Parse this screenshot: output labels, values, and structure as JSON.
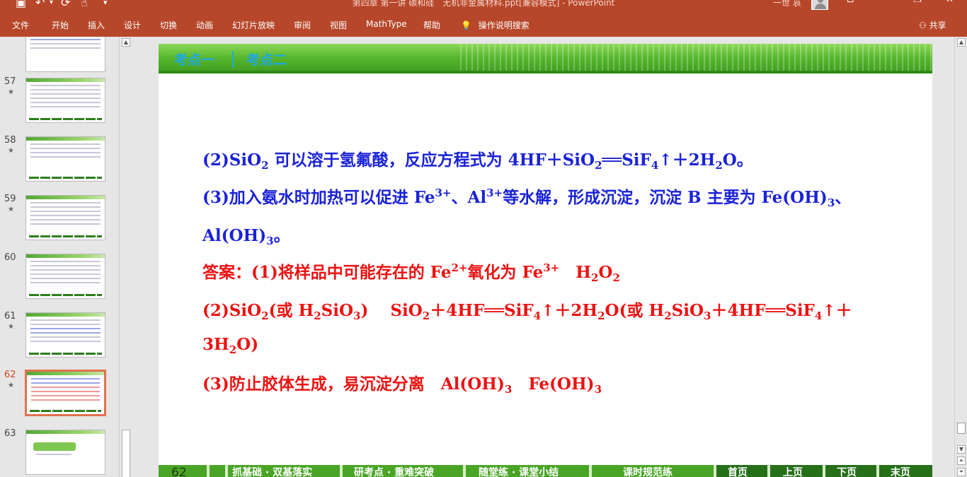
{
  "window": {
    "title": "第四章 第一讲 碳和硅　无机非金属材料.ppt[兼容模式] - PowerPoint",
    "user_name": "一世 哀",
    "quick_access": [
      "save-icon",
      "undo-icon",
      "redo-icon",
      "touch-mode-icon",
      "customize-icon"
    ]
  },
  "ribbon": {
    "tabs": [
      "文件",
      "开始",
      "插入",
      "设计",
      "切换",
      "动画",
      "幻灯片放映",
      "审阅",
      "视图",
      "MathType",
      "帮助"
    ],
    "tell_me": "操作说明搜索",
    "share": "共享"
  },
  "thumbnails": {
    "items": [
      {
        "number": "",
        "starred": false
      },
      {
        "number": "57",
        "starred": true
      },
      {
        "number": "58",
        "starred": true
      },
      {
        "number": "59",
        "starred": true
      },
      {
        "number": "60",
        "starred": false
      },
      {
        "number": "61",
        "starred": true
      },
      {
        "number": "62",
        "starred": true,
        "selected": true
      },
      {
        "number": "63",
        "starred": false
      }
    ],
    "star_glyph": "★"
  },
  "slide": {
    "header_tabs": [
      "考点一",
      "考点二"
    ],
    "line1": {
      "a": "(2)SiO",
      "b": "2",
      "c": " 可以溶于氢氟酸，反应方程式为 4HF＋SiO",
      "d": "2",
      "e": "══SiF",
      "f": "4",
      "g": "↑＋2H",
      "h": "2",
      "i": "O。"
    },
    "line2": {
      "a": "(3)加入氨水时加热可以促进 Fe",
      "b": "3+",
      "c": "、Al",
      "d": "3+",
      "e": "等水解，形成沉淀，沉淀 B 主要为 Fe(OH)",
      "f": "3",
      "g": "、"
    },
    "line3": {
      "a": "Al(OH)",
      "b": "3",
      "c": "。"
    },
    "line4": {
      "a": "答案：(1)将样品中可能存在的 Fe",
      "b": "2+",
      "c": "氧化为 Fe",
      "d": "3+",
      "e": "　H",
      "f": "2",
      "g": "O",
      "h": "2"
    },
    "line5": {
      "a": "(2)SiO",
      "b": "2",
      "c": "(或  H",
      "d": "2",
      "e": "SiO",
      "f": "3",
      "g": ")　 SiO",
      "h": "2",
      "i": "＋4HF══SiF",
      "j": "4",
      "k": "↑＋2H",
      "l": "2",
      "m": "O(或  H",
      "n": "2",
      "o": "SiO",
      "p": "3",
      "q": "＋4HF══SiF",
      "r": "4",
      "s": "↑＋"
    },
    "line6": {
      "a": "3H",
      "b": "2",
      "c": "O)"
    },
    "line7": {
      "a": "(3)防止胶体生成，易沉淀分离　Al(OH)",
      "b": "3",
      "c": "　Fe(OH)",
      "d": "3"
    },
    "footer": {
      "slide_number": "62",
      "nav": [
        "抓基础 · 双基落实",
        "研考点 · 重难突破",
        "随堂练 · 课堂小结",
        "课时规范练"
      ],
      "buttons": [
        "首页",
        "上页",
        "下页",
        "末页"
      ]
    }
  },
  "colors": {
    "ribbon": "#b7472a",
    "body_text": "#1a22d8",
    "answer_text": "#ee1111",
    "header_tab": "#1fa8e0",
    "footer_green": "#4aa526"
  }
}
